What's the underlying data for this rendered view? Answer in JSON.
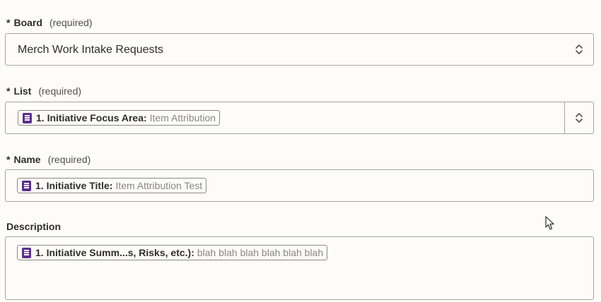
{
  "required_marker": "*",
  "required_text": "(required)",
  "board": {
    "label": "Board",
    "value": "Merch Work Intake Requests"
  },
  "list": {
    "label": "List",
    "pill": {
      "icon": "form-icon",
      "key": "1. Initiative Focus Area:",
      "value": "Item Attribution"
    }
  },
  "name": {
    "label": "Name",
    "pill": {
      "icon": "form-icon",
      "key": "1. Initiative Title:",
      "value": "Item Attribution Test"
    }
  },
  "description": {
    "label": "Description",
    "pill": {
      "icon": "form-icon",
      "key": "1. Initiative Summ...s, Risks, etc.):",
      "value": "blah blah blah blah blah blah"
    }
  },
  "colors": {
    "background": "#fdfcf8",
    "border": "#a8a5a1",
    "icon_purple": "#5c2d91",
    "muted_text": "#8a8784"
  }
}
